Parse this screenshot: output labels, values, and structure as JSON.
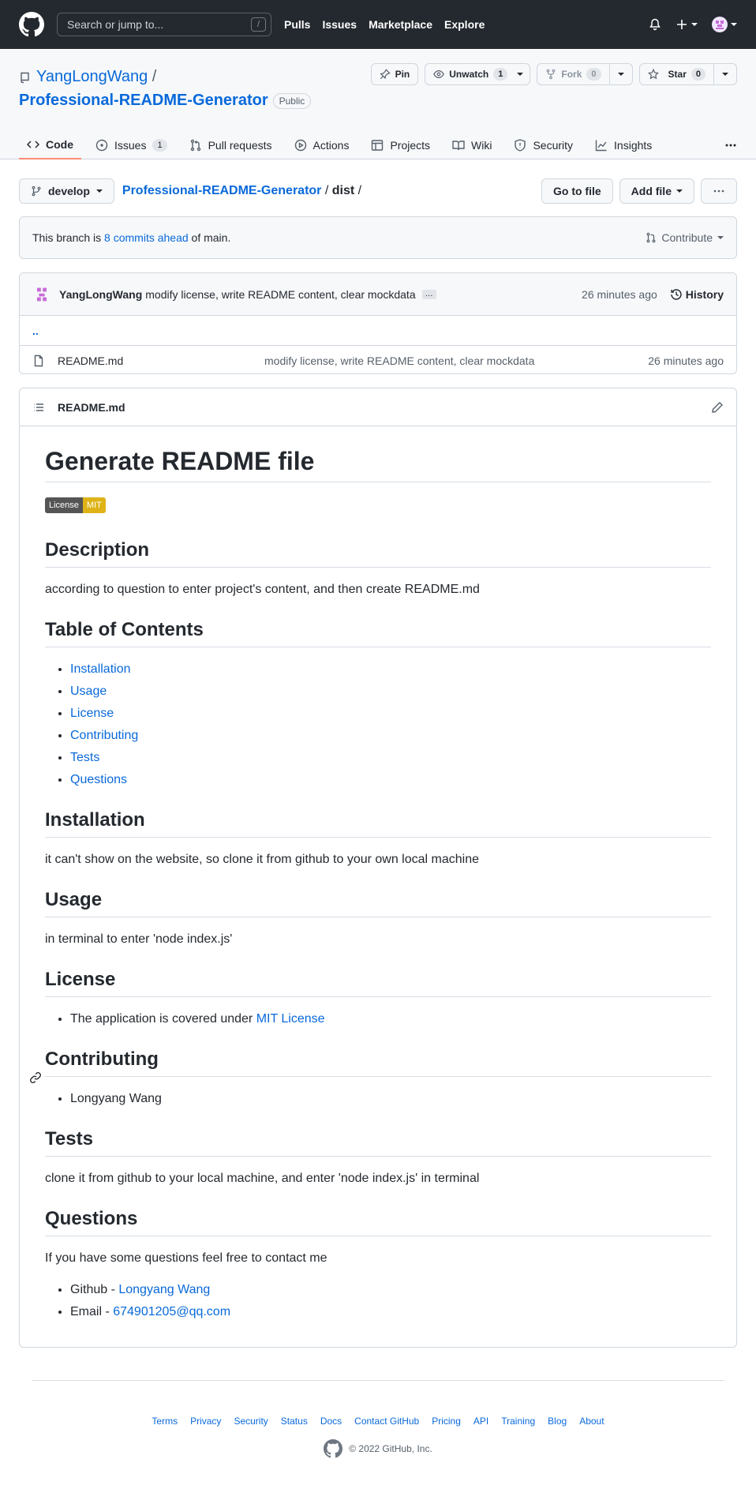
{
  "header": {
    "search_placeholder": "Search or jump to...",
    "slash": "/",
    "nav": [
      "Pulls",
      "Issues",
      "Marketplace",
      "Explore"
    ]
  },
  "repo": {
    "owner": "YangLongWang",
    "sep": "/",
    "name": "Professional-README-Generator",
    "visibility": "Public",
    "pin": "Pin",
    "unwatch": "Unwatch",
    "watch_count": "1",
    "fork": "Fork",
    "fork_count": "0",
    "star": "Star",
    "star_count": "0"
  },
  "tabs": [
    {
      "label": "Code"
    },
    {
      "label": "Issues",
      "count": "1"
    },
    {
      "label": "Pull requests"
    },
    {
      "label": "Actions"
    },
    {
      "label": "Projects"
    },
    {
      "label": "Wiki"
    },
    {
      "label": "Security"
    },
    {
      "label": "Insights"
    }
  ],
  "filenav": {
    "branch": "develop",
    "repo": "Professional-README-Generator",
    "sep1": " / ",
    "dir": "dist",
    "sep2": " /",
    "goto": "Go to file",
    "addfile": "Add file"
  },
  "flash": {
    "prefix": "This branch is ",
    "link": "8 commits ahead",
    "suffix": " of main.",
    "contribute": "Contribute"
  },
  "commit": {
    "author": "YangLongWang",
    "message": "modify license, write README content, clear mockdata",
    "ellipsis": "…",
    "time": "26 minutes ago",
    "history": "History"
  },
  "files": {
    "updir": "..",
    "name": "README.md",
    "message": "modify license, write README content, clear mockdata",
    "time": "26 minutes ago"
  },
  "readme": {
    "filename": "README.md",
    "title": "Generate README file",
    "badge_left": "License",
    "badge_right": "MIT",
    "h_description": "Description",
    "description": "according to question to enter project's content, and then create README.md",
    "h_toc": "Table of Contents",
    "toc": [
      "Installation",
      "Usage",
      "License",
      "Contributing",
      "Tests",
      "Questions"
    ],
    "h_installation": "Installation",
    "installation": "it can't show on the website, so clone it from github to your own local machine",
    "h_usage": "Usage",
    "usage": "in terminal to enter 'node index.js'",
    "h_license": "License",
    "license_text": "The application is covered under ",
    "license_link": "MIT License",
    "h_contributing": "Contributing",
    "contributor": "Longyang Wang",
    "h_tests": "Tests",
    "tests": "clone it from github to your local machine, and enter 'node index.js' in terminal",
    "h_questions": "Questions",
    "questions": "If you have some questions feel free to contact me",
    "github_label": "Github - ",
    "github_link": "Longyang Wang",
    "email_label": "Email - ",
    "email_link": "674901205@qq.com"
  },
  "footer": {
    "links": [
      "Terms",
      "Privacy",
      "Security",
      "Status",
      "Docs",
      "Contact GitHub",
      "Pricing",
      "API",
      "Training",
      "Blog",
      "About"
    ],
    "copyright": "© 2022 GitHub, Inc."
  }
}
